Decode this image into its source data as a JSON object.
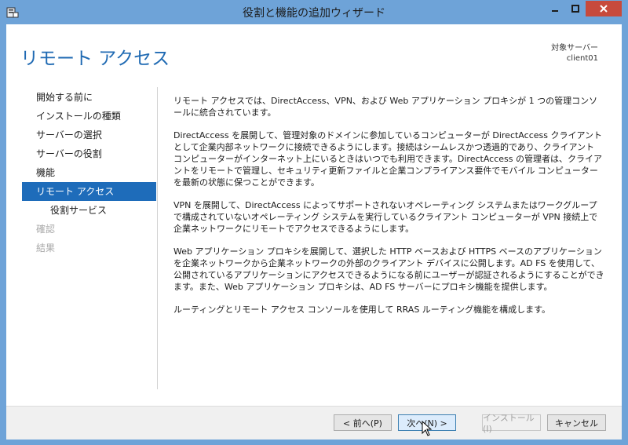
{
  "window": {
    "title": "役割と機能の追加ウィザード",
    "icons": {
      "app": "server-manager-icon",
      "minimize": "minimize-icon",
      "maximize": "maximize-icon",
      "close": "close-icon"
    }
  },
  "header": {
    "page_title": "リモート アクセス",
    "target_label": "対象サーバー",
    "target_server": "client01"
  },
  "nav": {
    "items": [
      {
        "label": "開始する前に",
        "state": "normal"
      },
      {
        "label": "インストールの種類",
        "state": "normal"
      },
      {
        "label": "サーバーの選択",
        "state": "normal"
      },
      {
        "label": "サーバーの役割",
        "state": "normal"
      },
      {
        "label": "機能",
        "state": "normal"
      },
      {
        "label": "リモート アクセス",
        "state": "active"
      },
      {
        "label": "役割サービス",
        "state": "sub"
      },
      {
        "label": "確認",
        "state": "disabled"
      },
      {
        "label": "結果",
        "state": "disabled"
      }
    ]
  },
  "content": {
    "paragraphs": [
      "リモート アクセスでは、DirectAccess、VPN、および Web アプリケーション プロキシが 1 つの管理コンソールに統合されています。",
      "DirectAccess を展開して、管理対象のドメインに参加しているコンピューターが DirectAccess クライアントとして企業内部ネットワークに接続できるようにします。接続はシームレスかつ透過的であり、クライアント コンピューターがインターネット上にいるときはいつでも利用できます。DirectAccess の管理者は、クライアントをリモートで管理し、セキュリティ更新ファイルと企業コンプライアンス要件でモバイル コンピューターを最新の状態に保つことができます。",
      "VPN を展開して、DirectAccess によってサポートされないオペレーティング システムまたはワークグループで構成されていないオペレーティング システムを実行しているクライアント コンピューターが VPN 接続上で企業ネットワークにリモートでアクセスできるようにします。",
      "Web アプリケーション プロキシを展開して、選択した HTTP ベースおよび HTTPS ベースのアプリケーションを企業ネットワークから企業ネットワークの外部のクライアント デバイスに公開します。AD FS を使用して、公開されているアプリケーションにアクセスできるようになる前にユーザーが認証されるようにすることができます。また、Web アプリケーション プロキシは、AD FS サーバーにプロキシ機能を提供します。",
      "ルーティングとリモート アクセス コンソールを使用して RRAS ルーティング機能を構成します。"
    ]
  },
  "footer": {
    "back_label": "< 前へ(P)",
    "next_label": "次へ(N) >",
    "install_label": "インストール(I)",
    "cancel_label": "キャンセル"
  },
  "colors": {
    "accent": "#1e6cba",
    "frame": "#6ea3d8",
    "close": "#c74a3c"
  }
}
